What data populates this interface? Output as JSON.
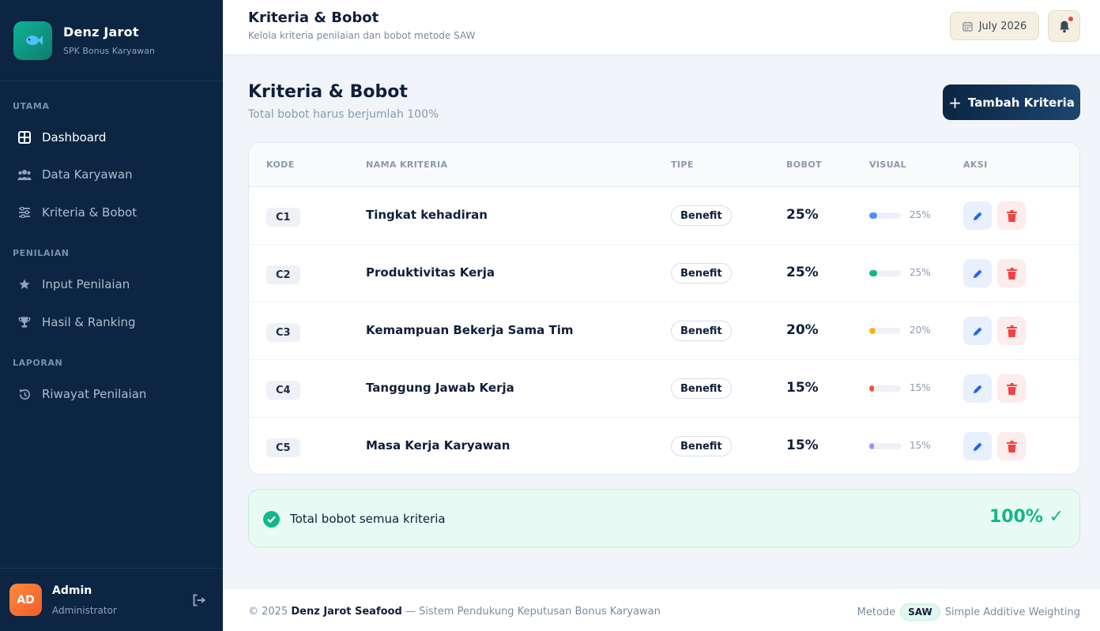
{
  "brand": {
    "name": "Denz Jarot",
    "subtitle": "SPK Bonus Karyawan",
    "logo_icon": "fish-icon"
  },
  "sidebar": {
    "sections": [
      {
        "label": "UTAMA"
      },
      {
        "label": "PENILAIAN"
      },
      {
        "label": "LAPORAN"
      }
    ],
    "items": [
      {
        "label": "Dashboard",
        "icon": "grid-icon",
        "active": true
      },
      {
        "label": "Data Karyawan",
        "icon": "users-icon"
      },
      {
        "label": "Kriteria & Bobot",
        "icon": "sliders-icon"
      },
      {
        "label": "Input Penilaian",
        "icon": "star-icon"
      },
      {
        "label": "Hasil & Ranking",
        "icon": "trophy-icon"
      },
      {
        "label": "Riwayat Penilaian",
        "icon": "history-icon"
      }
    ]
  },
  "user": {
    "initials": "AD",
    "name": "Admin",
    "role": "Administrator"
  },
  "topbar": {
    "title": "Kriteria & Bobot",
    "subtitle": "Kelola kriteria penilaian dan bobot metode SAW",
    "date": "July 2026"
  },
  "main": {
    "title": "Kriteria & Bobot",
    "subtitle": "Total bobot harus berjumlah 100%",
    "add_button": "Tambah Kriteria"
  },
  "table": {
    "headers": [
      "KODE",
      "NAMA KRITERIA",
      "TIPE",
      "BOBOT",
      "VISUAL",
      "AKSI"
    ],
    "rows": [
      {
        "code": "C1",
        "name": "Tingkat kehadiran",
        "type": "Benefit",
        "weight": "25%",
        "pct": "25%",
        "fraction": 0.25,
        "color": "#4f8ef7"
      },
      {
        "code": "C2",
        "name": "Produktivitas Kerja",
        "type": "Benefit",
        "weight": "25%",
        "pct": "25%",
        "fraction": 0.25,
        "color": "#10b981"
      },
      {
        "code": "C3",
        "name": "Kemampuan Bekerja Sama Tim",
        "type": "Benefit",
        "weight": "20%",
        "pct": "20%",
        "fraction": 0.2,
        "color": "#f5b812"
      },
      {
        "code": "C4",
        "name": "Tanggung Jawab Kerja",
        "type": "Benefit",
        "weight": "15%",
        "pct": "15%",
        "fraction": 0.15,
        "color": "#f0503c"
      },
      {
        "code": "C5",
        "name": "Masa Kerja Karyawan",
        "type": "Benefit",
        "weight": "15%",
        "pct": "15%",
        "fraction": 0.15,
        "color": "#a78bfa"
      }
    ]
  },
  "total": {
    "label": "Total bobot semua kriteria",
    "value": "100% ✓"
  },
  "footer": {
    "copyright": "© 2025",
    "company": "Denz Jarot Seafood",
    "tagline": "— Sistem Pendukung Keputusan Bonus Karyawan",
    "method_label": "Metode",
    "method_badge": "SAW",
    "method_name": "Simple Additive Weighting"
  }
}
